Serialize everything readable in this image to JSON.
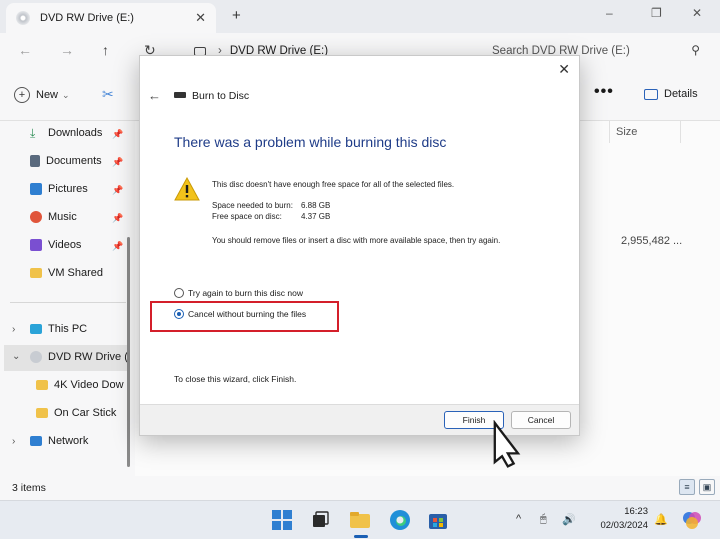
{
  "explorer": {
    "tab_title": "DVD RW Drive (E:)",
    "tab_close": "✕",
    "tab_new": "+",
    "window_controls": {
      "minimize": "–",
      "maximize": "❐",
      "close": "✕"
    },
    "nav": {
      "back": "←",
      "forward": "→",
      "up": "↑",
      "refresh": "↻"
    },
    "address_path": "DVD RW Drive (E:)",
    "address_separator": "›",
    "search_placeholder": "Search DVD RW Drive (E:)",
    "toolbar": {
      "new_label": "New",
      "new_caret": "⌄",
      "more_label": "•••",
      "details_label": "Details"
    },
    "sidebar": {
      "quick_access": [
        {
          "label": "Downloads",
          "icon": "download-icon",
          "color": "#2f8f57"
        },
        {
          "label": "Documents",
          "icon": "documents-icon",
          "color": "#5a6a7e"
        },
        {
          "label": "Pictures",
          "icon": "pictures-icon",
          "color": "#2f7fd1"
        },
        {
          "label": "Music",
          "icon": "music-icon",
          "color": "#e0553b"
        },
        {
          "label": "Videos",
          "icon": "videos-icon",
          "color": "#7a4fd1"
        },
        {
          "label": "VM Shared",
          "icon": "folder-icon",
          "color": "#f0c24a"
        }
      ],
      "this_pc": "This PC",
      "dvd_drive": "DVD RW Drive (",
      "drive_children": [
        "4K Video Dow",
        "On Car Stick"
      ],
      "network": "Network"
    },
    "content": {
      "size_header": "Size",
      "size_value": "2,955,482 ..."
    },
    "status": "3 items"
  },
  "dialog": {
    "close": "✕",
    "back": "←",
    "title": "Burn to Disc",
    "heading": "There was a problem while burning this disc",
    "message": "This disc doesn't have enough free space for all of the selected files.",
    "space_needed_label": "Space needed to burn:",
    "space_needed_value": "6.88 GB",
    "free_space_label": "Free space on disc:",
    "free_space_value": "4.37 GB",
    "advice": "You should remove files or insert a disc with more available space, then try again.",
    "options": [
      {
        "label": "Try again to burn this disc now",
        "checked": false
      },
      {
        "label": "Cancel without burning the files",
        "checked": true
      }
    ],
    "close_hint": "To close this wizard, click Finish.",
    "finish": "Finish",
    "cancel": "Cancel",
    "colors": {
      "heading": "#1f3c88",
      "highlight": "#d41f2a",
      "warning": "#f2c21b"
    }
  },
  "taskbar": {
    "tray_caret": "^",
    "time": "16:23",
    "date": "02/03/2024"
  }
}
